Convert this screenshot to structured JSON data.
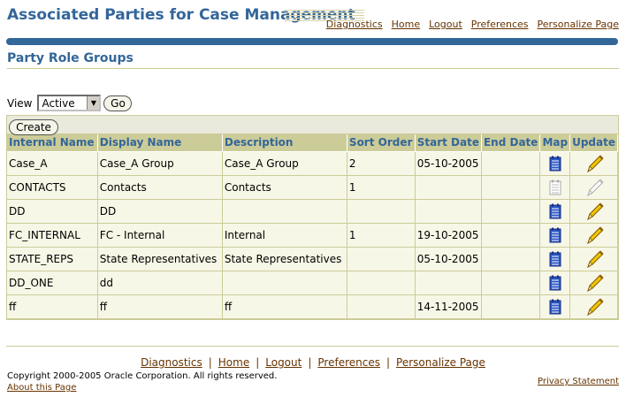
{
  "app": {
    "title": "Associated Parties for Case Management"
  },
  "global_links": [
    "Diagnostics",
    "Home",
    "Logout",
    "Preferences",
    "Personalize Page"
  ],
  "page": {
    "title": "Party Role Groups"
  },
  "view": {
    "label": "View",
    "selected": "Active",
    "go_label": "Go"
  },
  "table": {
    "create_label": "Create",
    "columns": [
      "Internal Name",
      "Display Name",
      "Description",
      "Sort Order",
      "Start Date",
      "End Date",
      "Map",
      "Update"
    ],
    "rows": [
      {
        "internal": "Case_A",
        "display": "Case_A Group",
        "description": "Case_A Group",
        "sort": "2",
        "start": "05-10-2005",
        "end": "",
        "enabled": true
      },
      {
        "internal": "CONTACTS",
        "display": "Contacts",
        "description": "Contacts",
        "sort": "1",
        "start": "",
        "end": "",
        "enabled": false
      },
      {
        "internal": "DD",
        "display": "DD",
        "description": "",
        "sort": "",
        "start": "",
        "end": "",
        "enabled": true
      },
      {
        "internal": "FC_INTERNAL",
        "display": "FC - Internal",
        "description": "Internal",
        "sort": "1",
        "start": "19-10-2005",
        "end": "",
        "enabled": true
      },
      {
        "internal": "STATE_REPS",
        "display": "State Representatives",
        "description": "State Representatives",
        "sort": "",
        "start": "05-10-2005",
        "end": "",
        "enabled": true
      },
      {
        "internal": "DD_ONE",
        "display": "dd",
        "description": "",
        "sort": "",
        "start": "",
        "end": "",
        "enabled": true
      },
      {
        "internal": "ff",
        "display": "ff",
        "description": "ff",
        "sort": "",
        "start": "14-11-2005",
        "end": "",
        "enabled": true
      }
    ]
  },
  "footer": {
    "links": [
      "Diagnostics",
      "Home",
      "Logout",
      "Preferences",
      "Personalize Page"
    ],
    "copyright": "Copyright 2000-2005 Oracle Corporation. All rights reserved.",
    "about": "About this Page",
    "privacy": "Privacy Statement"
  },
  "colors": {
    "brand": "#336699",
    "header_bg": "#cccc99",
    "row_bg": "#f7f7e7",
    "link": "#663300"
  },
  "icons": {
    "map": "map-icon",
    "update": "pencil-icon"
  }
}
